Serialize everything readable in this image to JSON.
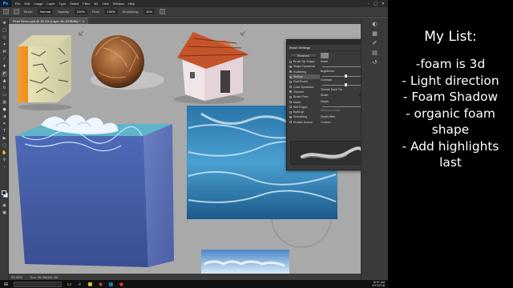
{
  "app": {
    "name": "Ps",
    "menus": [
      "File",
      "Edit",
      "Image",
      "Layer",
      "Type",
      "Select",
      "Filter",
      "3D",
      "View",
      "Window",
      "Help"
    ]
  },
  "options_bar": {
    "mode_label": "Mode:",
    "mode_value": "Normal",
    "opacity_label": "Opacity:",
    "opacity_value": "100%",
    "flow_label": "Flow:",
    "flow_value": "100%",
    "smoothing_label": "Smoothing:",
    "smoothing_value": "10%"
  },
  "document": {
    "tab_title": "Final Demo.psd @ 33.3% (Layer 30, RGB/8#) *",
    "zoom": "33.33%",
    "doc_size": "Doc: 98.3M/181.4M"
  },
  "brush_panel": {
    "tabs": [
      "Brush Settings"
    ],
    "brushes_button": "Brushes",
    "items": [
      {
        "label": "Brush Tip Shape",
        "checked": false,
        "selected": false
      },
      {
        "label": "Shape Dynamics",
        "checked": true,
        "selected": false
      },
      {
        "label": "Scattering",
        "checked": true,
        "selected": false
      },
      {
        "label": "Texture",
        "checked": true,
        "selected": true
      },
      {
        "label": "Dual Brush",
        "checked": false,
        "selected": false
      },
      {
        "label": "Color Dynamics",
        "checked": false,
        "selected": false
      },
      {
        "label": "Transfer",
        "checked": true,
        "selected": false
      },
      {
        "label": "Brush Pose",
        "checked": false,
        "selected": false
      },
      {
        "label": "Noise",
        "checked": false,
        "selected": false
      },
      {
        "label": "Wet Edges",
        "checked": false,
        "selected": false
      },
      {
        "label": "Build-up",
        "checked": false,
        "selected": false
      },
      {
        "label": "Smoothing",
        "checked": true,
        "selected": false
      },
      {
        "label": "Protect Texture",
        "checked": false,
        "selected": false
      }
    ],
    "invert_label": "Invert",
    "scale_label": "Scale",
    "scale_value": "87%",
    "brightness_label": "Brightness",
    "brightness_value": "0",
    "contrast_label": "Contrast",
    "contrast_value": "0",
    "texture_each_tip_label": "Texture Each Tip",
    "mode_label": "Mode:",
    "mode_value": "Multiply",
    "depth_label": "Depth",
    "depth_value": "100%",
    "min_depth_label": "Minimum Depth",
    "depth_jitter_label": "Depth Jitter",
    "depth_jitter_value": "0%",
    "control_label": "Control:",
    "control_value": "Off"
  },
  "taskbar": {
    "search_placeholder": "",
    "time": "10:57 AM",
    "date": "2/27/2018"
  },
  "notes": {
    "title": "My List:",
    "items": [
      "-foam is 3d",
      "- Light direction",
      "- Foam Shadow",
      "- organic foam",
      "shape",
      "- Add highlights",
      "last"
    ]
  },
  "colors": {
    "ps_blue": "#31a8ff",
    "canvas_gray": "#a9a9a9",
    "panel_dark": "#3a3a3a",
    "foreground_color": "#1c2d49",
    "background_color": "#dff3ff"
  }
}
